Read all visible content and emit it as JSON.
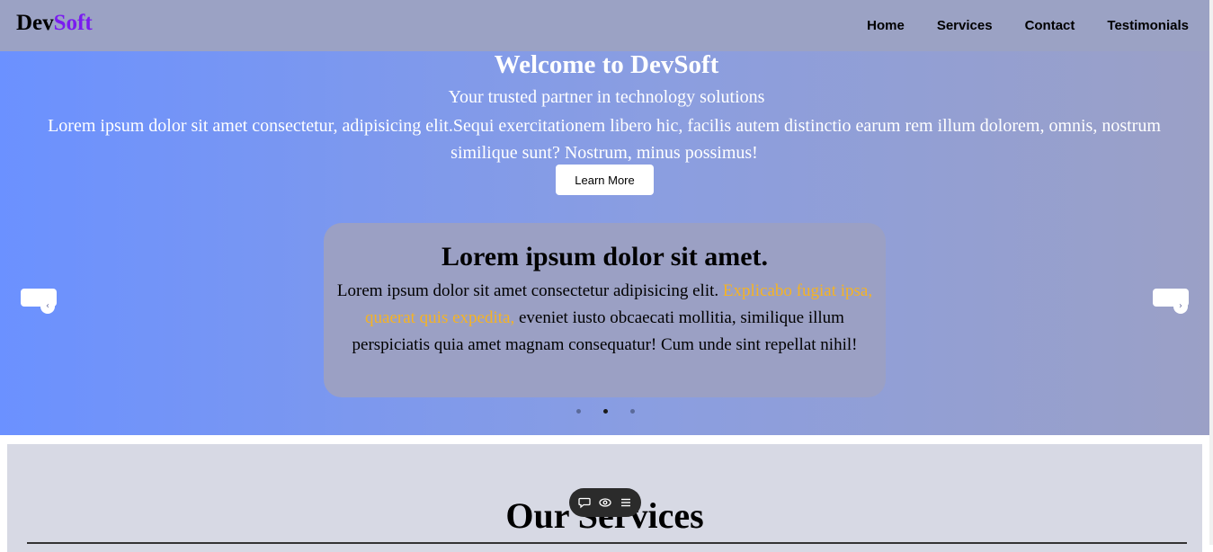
{
  "brand": {
    "prefix": "Dev",
    "suffix": "Soft",
    "accent_color": "#7a1bf0"
  },
  "nav": {
    "items": [
      "Home",
      "Services",
      "Contact",
      "Testimonials"
    ]
  },
  "hero": {
    "title": "Welcome to DevSoft",
    "subtitle": "Your trusted partner in technology solutions",
    "description": "Lorem ipsum dolor sit amet consectetur, adipisicing elit.Sequi exercitationem libero hic, facilis autem distinctio earum rem illum dolorem, omnis, nostrum similique sunt? Nostrum, minus possimus!",
    "cta_label": "Learn More"
  },
  "carousel": {
    "slide_title": "Lorem ipsum dolor sit amet.",
    "text_before": "Lorem ipsum dolor sit amet consectetur adipisicing elit. ",
    "text_highlight": "Explicabo fugiat ipsa, quaerat quis expedita,",
    "text_after": " eveniet iusto obcaecati mollitia, similique illum perspiciatis quia amet magnam consequatur! Cum unde sint repellat nihil!",
    "highlight_color": "#f5b324",
    "prev_icon": "chevron-left-icon",
    "next_icon": "chevron-right-icon",
    "active_index": 1,
    "slide_count": 3
  },
  "services": {
    "title": "Our Services"
  },
  "toolbar": {
    "icons": [
      "comment-icon",
      "eye-icon",
      "menu-icon"
    ]
  }
}
